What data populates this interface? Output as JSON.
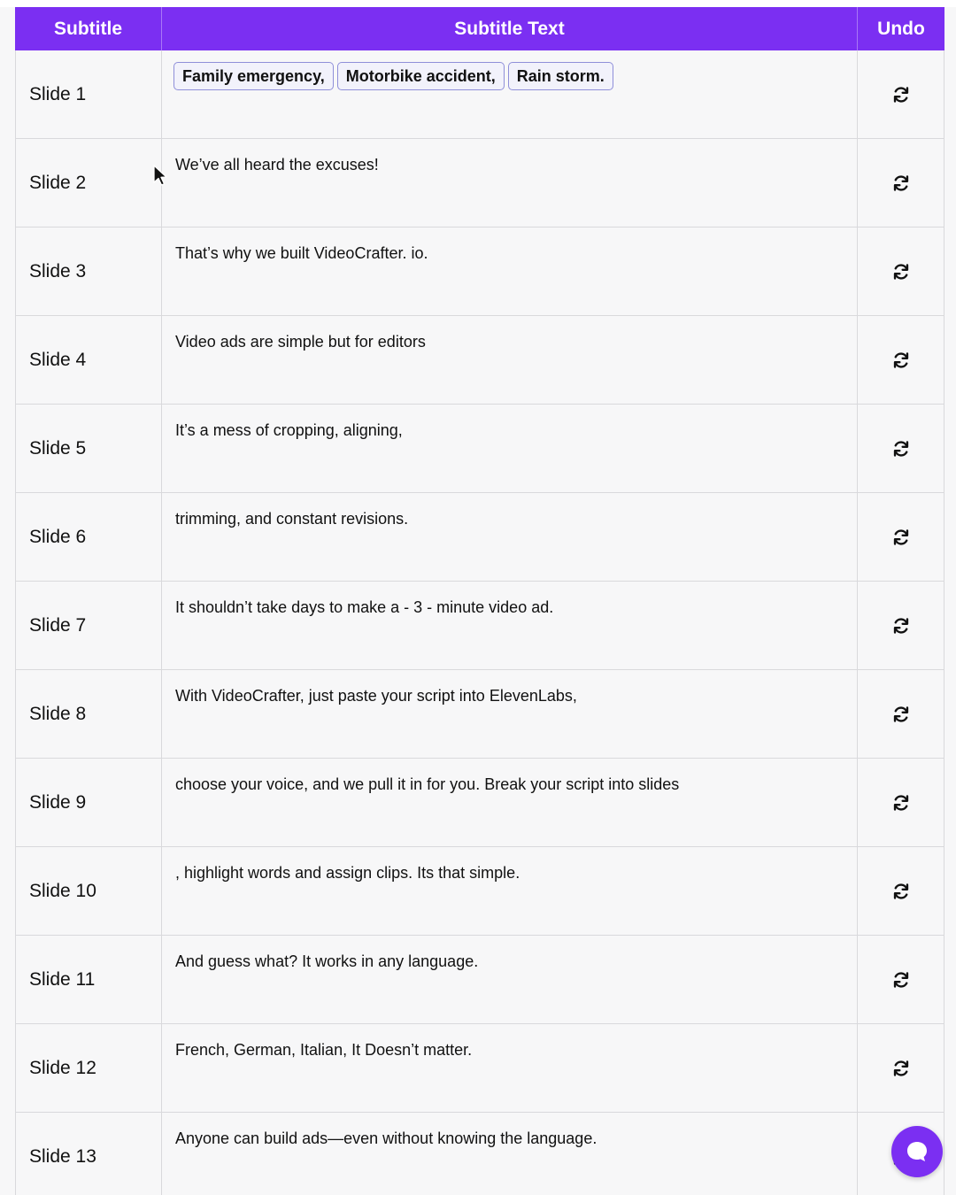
{
  "header": {
    "col_subtitle": "Subtitle",
    "col_text": "Subtitle Text",
    "col_undo": "Undo"
  },
  "rows": [
    {
      "slide": "Slide 1",
      "chips": [
        "Family emergency,",
        "Motorbike accident,",
        "Rain storm."
      ]
    },
    {
      "slide": "Slide 2",
      "text": "We’ve all heard the excuses!"
    },
    {
      "slide": "Slide 3",
      "text": "That’s why we built VideoCrafter. io."
    },
    {
      "slide": "Slide 4",
      "text": "Video ads are simple but for editors"
    },
    {
      "slide": "Slide 5",
      "text": "It’s a mess of cropping, aligning,"
    },
    {
      "slide": "Slide 6",
      "text": "trimming, and constant revisions."
    },
    {
      "slide": "Slide 7",
      "text": "It shouldn’t take days to make a - 3 - minute video ad."
    },
    {
      "slide": "Slide 8",
      "text": "With VideoCrafter, just paste your script into ElevenLabs,"
    },
    {
      "slide": "Slide 9",
      "text": "choose your voice, and we pull it in for you. Break your script into slides"
    },
    {
      "slide": "Slide 10",
      "text": ", highlight words and assign clips. Its that simple."
    },
    {
      "slide": "Slide 11",
      "text": "And guess what? It works in any language."
    },
    {
      "slide": "Slide 12",
      "text": "French, German, Italian, It Doesn’t matter."
    },
    {
      "slide": "Slide 13",
      "text": "Anyone can build ads—even without knowing the language."
    }
  ],
  "icons": {
    "undo": "refresh-icon",
    "chat": "chat-bubble-icon",
    "cursor": "mouse-pointer-icon"
  },
  "colors": {
    "header_bg": "#7b2ff2",
    "chip_border": "#8f8fd9",
    "chat_bg": "#7b2ff2"
  }
}
